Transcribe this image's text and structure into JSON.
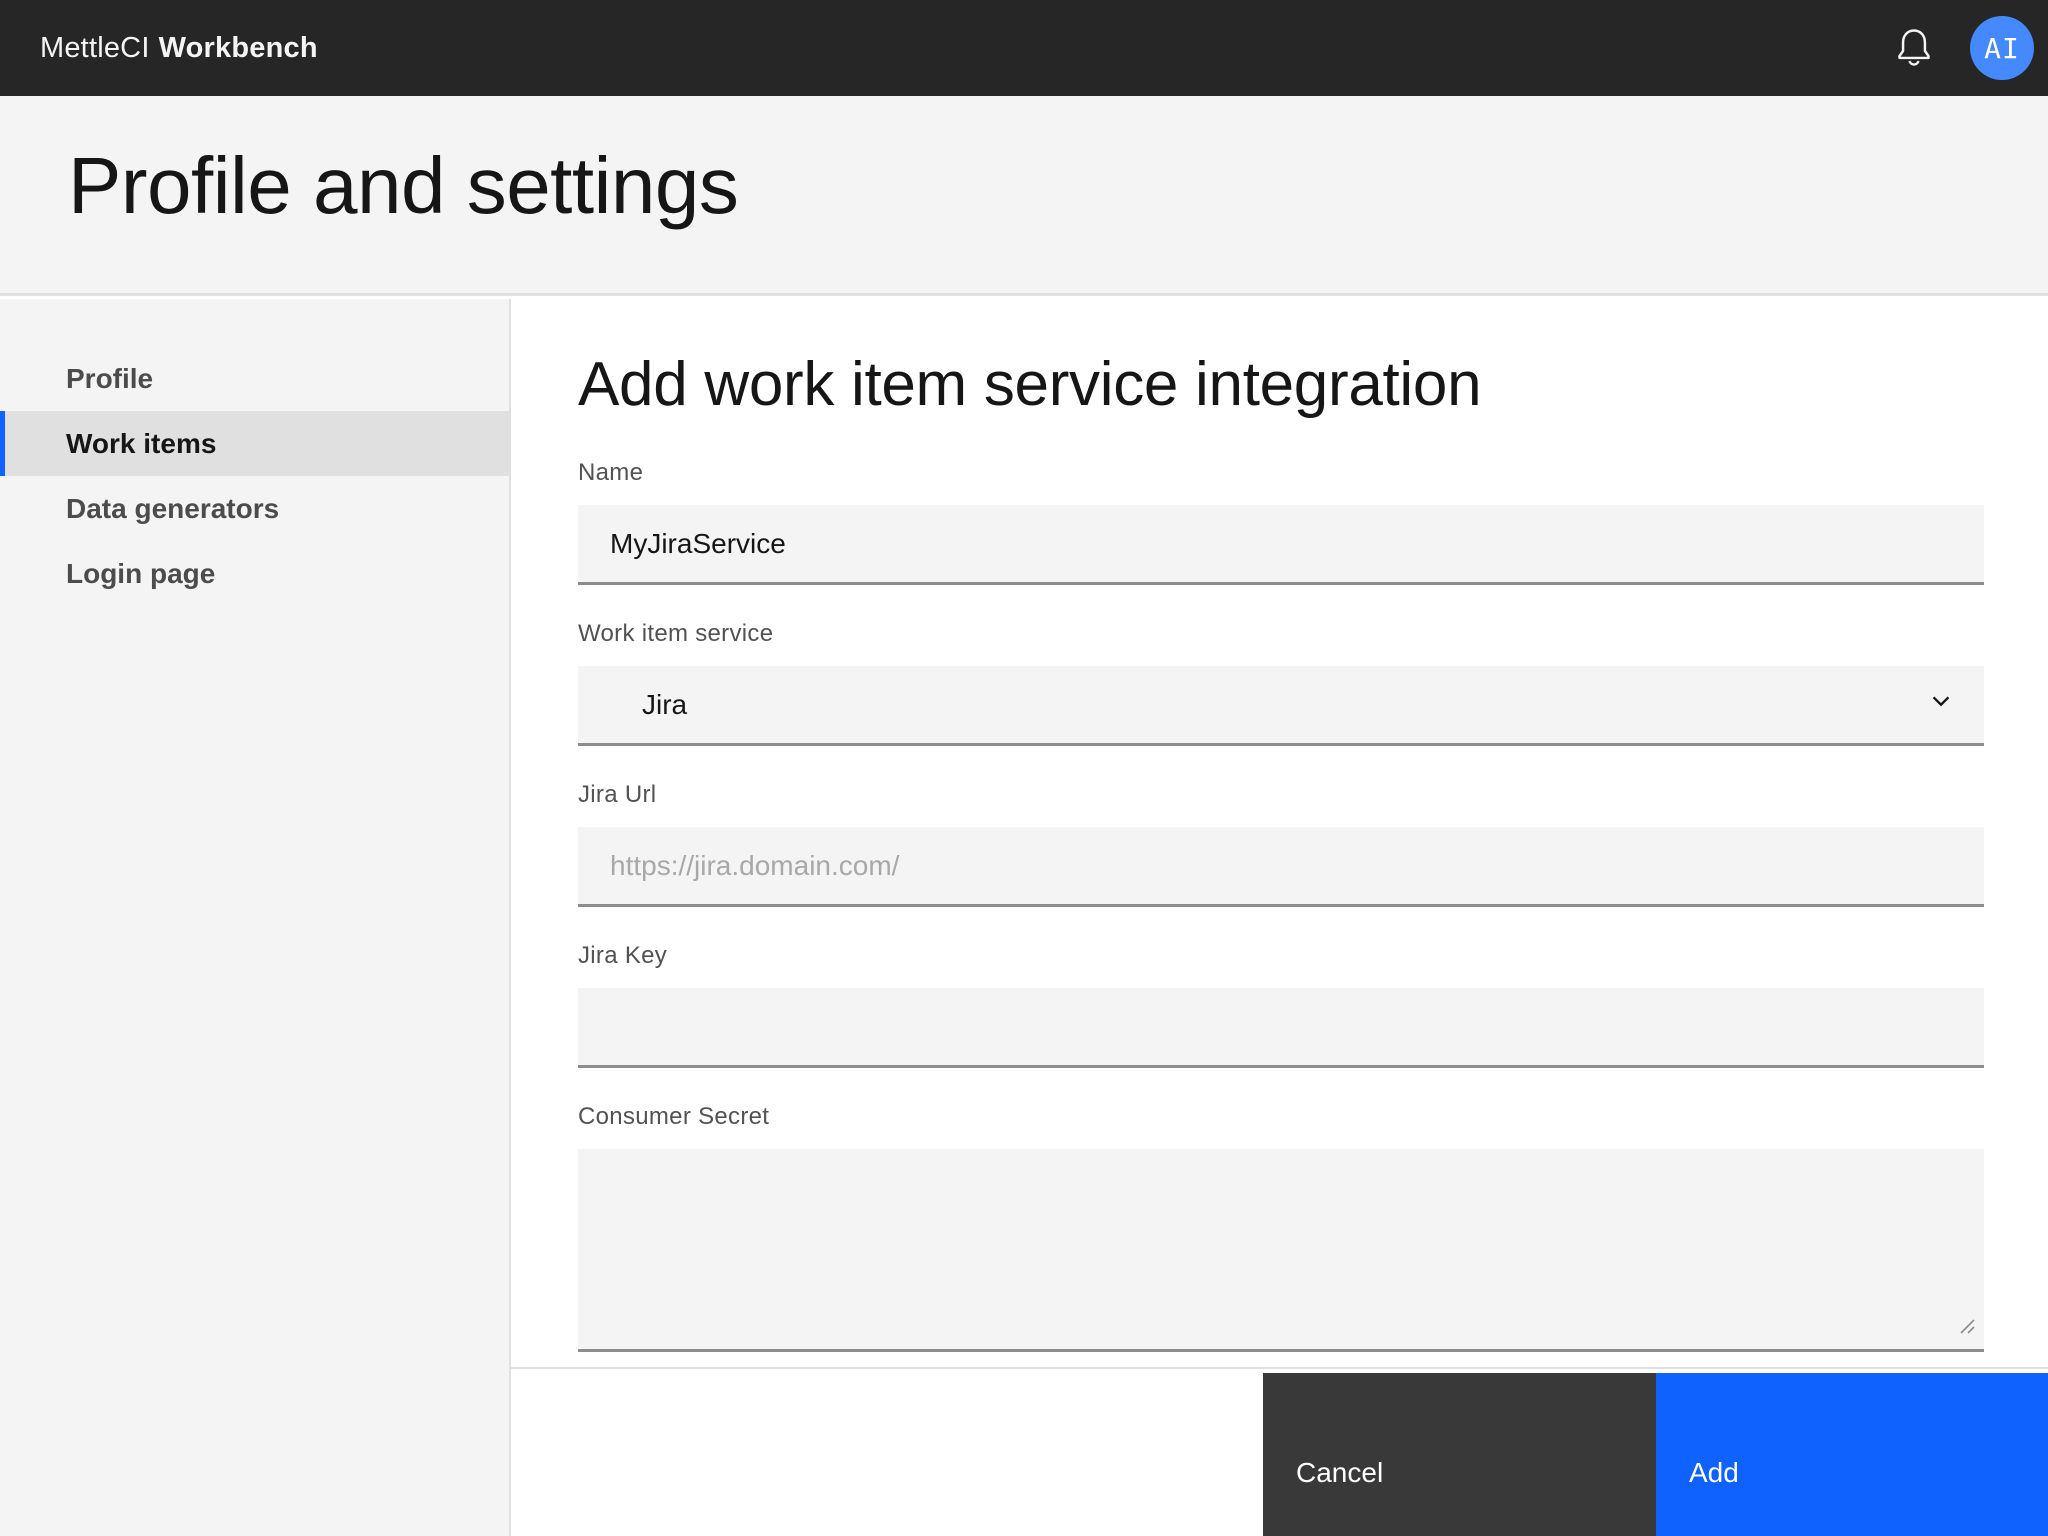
{
  "header": {
    "brand_prefix": "MettleCI",
    "brand_product": "Workbench",
    "avatar_initials": "AI"
  },
  "page": {
    "title": "Profile and settings"
  },
  "sidebar": {
    "items": [
      {
        "label": "Profile",
        "active": false
      },
      {
        "label": "Work items",
        "active": true
      },
      {
        "label": "Data generators",
        "active": false
      },
      {
        "label": "Login page",
        "active": false
      }
    ]
  },
  "main": {
    "heading": "Add work item service integration",
    "form": {
      "name": {
        "label": "Name",
        "value": "MyJiraService"
      },
      "work_item_service": {
        "label": "Work item service",
        "value": "Jira"
      },
      "jira_url": {
        "label": "Jira Url",
        "value": "",
        "placeholder": "https://jira.domain.com/"
      },
      "jira_key": {
        "label": "Jira Key",
        "value": ""
      },
      "consumer_secret": {
        "label": "Consumer Secret",
        "value": ""
      }
    },
    "actions": {
      "cancel": "Cancel",
      "add": "Add"
    }
  },
  "colors": {
    "header_bg": "#262626",
    "accent_blue": "#0f62fe",
    "avatar_blue": "#4589ff",
    "secondary_button": "#393939",
    "field_bg": "#f4f4f4",
    "selected_row_bg": "#e0e0e0"
  }
}
